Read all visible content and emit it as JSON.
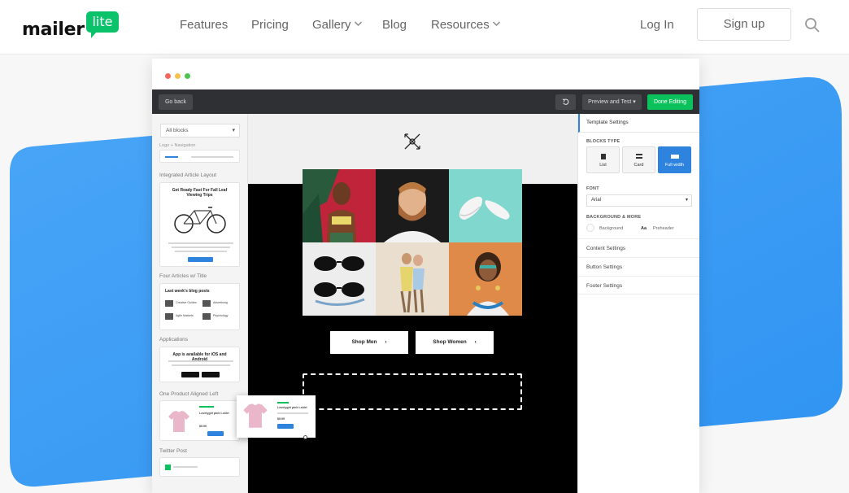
{
  "logo": {
    "word": "mailer",
    "badge": "lite"
  },
  "nav": {
    "features": "Features",
    "pricing": "Pricing",
    "gallery": "Gallery",
    "blog": "Blog",
    "resources": "Resources",
    "login": "Log In",
    "signup": "Sign up"
  },
  "editor": {
    "go_back": "Go back",
    "preview": "Preview and Test",
    "done": "Done Editing",
    "blocks_select": "All blocks",
    "left": {
      "cut_title": "Logo + Navigation",
      "sec1": "Integrated Article Layout",
      "card1_title": "Get Ready Fast For Fall Leaf Viewing Trips",
      "sec2": "Four Articles w/ Title",
      "card2_title": "Last week's blog posts",
      "card2_items": [
        "Creative Guides",
        "Advertising",
        "Agile Markets",
        "Psychology"
      ],
      "sec3": "Applications",
      "card3_title": "App is available for iOS and Android",
      "sec4": "One Product Aligned Left",
      "card4_title": "Lovelygirl pink t-shirt",
      "card4_price": "$9.99",
      "sec5": "Twitter Post"
    },
    "canvas": {
      "shop_men": "Shop Men",
      "shop_women": "Shop Women",
      "drag_title": "Lovelygirl pink t-shirt",
      "drag_price": "$9.99"
    },
    "right": {
      "template_settings": "Template Settings",
      "blocks_type": "BLOCKS TYPE",
      "types": [
        "List",
        "Card",
        "Full width"
      ],
      "font": "FONT",
      "font_value": "Arial",
      "bg_more": "BACKGROUND & MORE",
      "background": "Background",
      "preheader": "Preheader",
      "aa": "Aa",
      "content_settings": "Content Settings",
      "button_settings": "Button Settings",
      "footer_settings": "Footer Settings"
    }
  },
  "colors": {
    "brand_green": "#09c269",
    "accent_blue": "#2d83de",
    "deco_blue": "#3a9cf5",
    "toolbar": "#2f3033"
  },
  "icons": [
    "search-icon",
    "chevron-down-icon",
    "undo-icon",
    "list-icon",
    "card-icon",
    "full-width-icon",
    "chevron-right-icon"
  ]
}
